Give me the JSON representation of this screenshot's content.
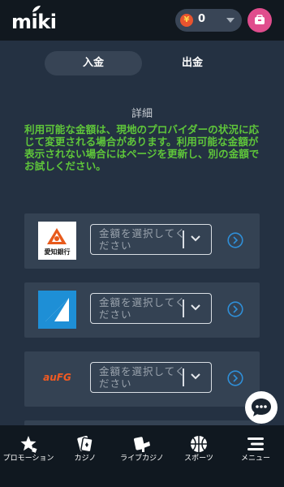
{
  "header": {
    "logo_text": "miki",
    "balance_value": "0",
    "currency_symbol": "¥"
  },
  "tabs": [
    {
      "label": "入金",
      "active": true
    },
    {
      "label": "出金",
      "active": false
    }
  ],
  "detail": {
    "title": "詳細",
    "notice": "利用可能な金額は、現地のプロバイダーの状況に応じて変更される場合があります。利用可能な金額が表示されない場合にはページを更新し、別の金額でお試しください。"
  },
  "banks": [
    {
      "logo_icon": "aichi-bank-logo",
      "logo_text": "愛知銀行",
      "select_placeholder": "金額を選択してください"
    },
    {
      "logo_icon": "blue-bank-logo",
      "select_placeholder": "金額を選択してください"
    },
    {
      "logo_icon": "au-fg-logo",
      "logo_text": "auFG",
      "select_placeholder": "金額を選択してください"
    }
  ],
  "bottom_nav": [
    {
      "label": "プロモーション",
      "icon": "promotion-star-icon"
    },
    {
      "label": "カジノ",
      "icon": "casino-cards-icon"
    },
    {
      "label": "ライブカジノ",
      "icon": "live-casino-icon"
    },
    {
      "label": "スポーツ",
      "icon": "basketball-icon"
    },
    {
      "label": "メニュー",
      "icon": "menu-icon"
    }
  ],
  "colors": {
    "background": "#243142",
    "header": "#11181f",
    "card": "#344253",
    "notice_green": "#5fc63a",
    "accent_blue": "#2f8fd8",
    "wallet_pink": "#e04d8d"
  }
}
